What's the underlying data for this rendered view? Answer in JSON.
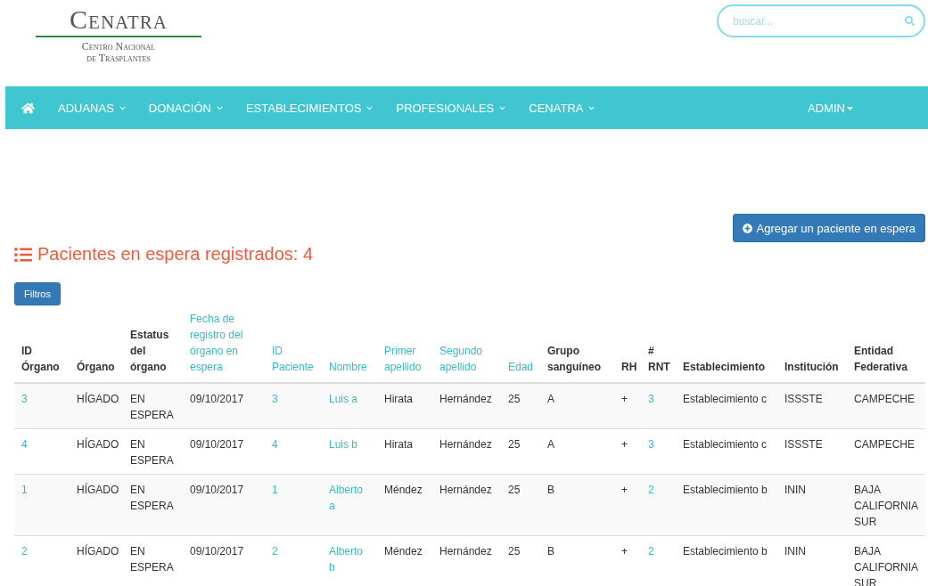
{
  "logo": {
    "title": "Cenatra",
    "subtitle_1": "Centro Nacional",
    "subtitle_2": "de Trasplantes"
  },
  "search": {
    "placeholder": "buscar..."
  },
  "nav": {
    "items": [
      {
        "kind": "home"
      },
      {
        "kind": "menu",
        "label": "ADUANAS"
      },
      {
        "kind": "menu",
        "label": "DONACIÓN"
      },
      {
        "kind": "menu",
        "label": "ESTABLECIMIENTOS"
      },
      {
        "kind": "menu",
        "label": "PROFESIONALES"
      },
      {
        "kind": "menu",
        "label": "CENATRA"
      }
    ],
    "user": "ADMIN"
  },
  "add_button": "Agregar un paciente en espera",
  "heading": "Pacientes en espera registrados: 4",
  "filter_button": "Filtros",
  "table": {
    "columns": [
      {
        "label": "ID Órgano",
        "sortable": false,
        "linked": true
      },
      {
        "label": "Órgano",
        "sortable": false,
        "linked": false
      },
      {
        "label": "Estatus del órgano",
        "sortable": false,
        "linked": false
      },
      {
        "label": "Fecha de registro del órgano en espera",
        "sortable": true,
        "linked": false
      },
      {
        "label": "ID Paciente",
        "sortable": true,
        "linked": true
      },
      {
        "label": "Nombre",
        "sortable": true,
        "linked": true
      },
      {
        "label": "Primer apellido",
        "sortable": true,
        "linked": false
      },
      {
        "label": "Segundo apellido",
        "sortable": true,
        "linked": false
      },
      {
        "label": "Edad",
        "sortable": true,
        "linked": false
      },
      {
        "label": "Grupo sanguíneo",
        "sortable": false,
        "linked": false
      },
      {
        "label": "RH",
        "sortable": false,
        "linked": false
      },
      {
        "label": "# RNT",
        "sortable": false,
        "linked": true
      },
      {
        "label": "Establecimiento",
        "sortable": false,
        "linked": false
      },
      {
        "label": "Institución",
        "sortable": false,
        "linked": false
      },
      {
        "label": "Entidad Federativa",
        "sortable": false,
        "linked": false
      }
    ],
    "rows": [
      [
        "3",
        "HÍGADO",
        "EN ESPERA",
        "09/10/2017",
        "3",
        "Luis a",
        "Hirata",
        "Hernández",
        "25",
        "A",
        "+",
        "3",
        "Establecimiento c",
        "ISSSTE",
        "CAMPECHE"
      ],
      [
        "4",
        "HÍGADO",
        "EN ESPERA",
        "09/10/2017",
        "4",
        "Luis b",
        "Hirata",
        "Hernández",
        "25",
        "A",
        "+",
        "3",
        "Establecimiento c",
        "ISSSTE",
        "CAMPECHE"
      ],
      [
        "1",
        "HÍGADO",
        "EN ESPERA",
        "09/10/2017",
        "1",
        "Alberto a",
        "Méndez",
        "Hernández",
        "25",
        "B",
        "+",
        "2",
        "Establecimiento b",
        "ININ",
        "BAJA CALIFORNIA SUR"
      ],
      [
        "2",
        "HÍGADO",
        "EN ESPERA",
        "09/10/2017",
        "2",
        "Alberto b",
        "Méndez",
        "Hernández",
        "25",
        "B",
        "+",
        "2",
        "Establecimiento b",
        "ININ",
        "BAJA CALIFORNIA SUR"
      ]
    ]
  }
}
